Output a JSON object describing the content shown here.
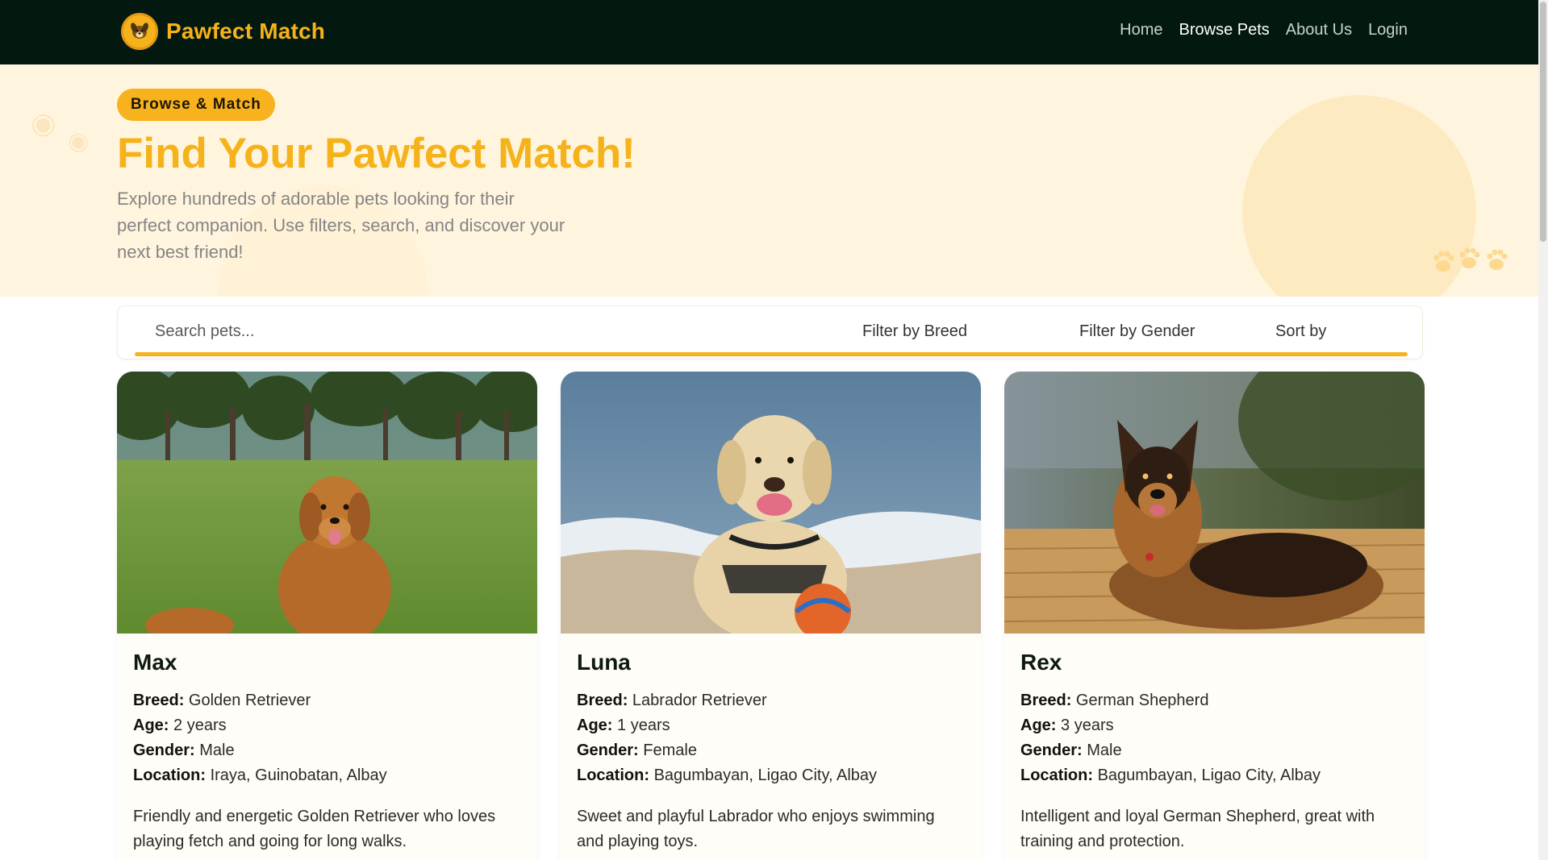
{
  "brand": {
    "name": "Pawfect Match",
    "logo_icon": "dog-face-icon"
  },
  "nav": {
    "items": [
      {
        "label": "Home",
        "active": false
      },
      {
        "label": "Browse Pets",
        "active": true
      },
      {
        "label": "About Us",
        "active": false
      },
      {
        "label": "Login",
        "active": false
      }
    ]
  },
  "hero": {
    "badge": "Browse & Match",
    "title": "Find Your Pawfect Match!",
    "subtitle": "Explore hundreds of adorable pets looking for their perfect companion. Use filters, search, and discover your next best friend!"
  },
  "filters": {
    "search_placeholder": "Search pets...",
    "breed_label": "Filter by Breed",
    "gender_label": "Filter by Gender",
    "sort_label": "Sort by"
  },
  "labels": {
    "breed": "Breed:",
    "age": "Age:",
    "gender": "Gender:",
    "location": "Location:"
  },
  "pets": [
    {
      "name": "Max",
      "breed": "Golden Retriever",
      "age": "2 years",
      "gender": "Male",
      "location": "Iraya, Guinobatan, Albay",
      "description": "Friendly and energetic Golden Retriever who loves playing fetch and going for long walks."
    },
    {
      "name": "Luna",
      "breed": "Labrador Retriever",
      "age": "1 years",
      "gender": "Female",
      "location": "Bagumbayan, Ligao City, Albay",
      "description": "Sweet and playful Labrador who enjoys swimming and playing toys."
    },
    {
      "name": "Rex",
      "breed": "German Shepherd",
      "age": "3 years",
      "gender": "Male",
      "location": "Bagumbayan, Ligao City, Albay",
      "description": "Intelligent and loyal German Shepherd, great with training and protection."
    }
  ],
  "colors": {
    "navbar": "#03190f",
    "accent": "#f6b21b",
    "hero_bg": "#fff5de"
  }
}
